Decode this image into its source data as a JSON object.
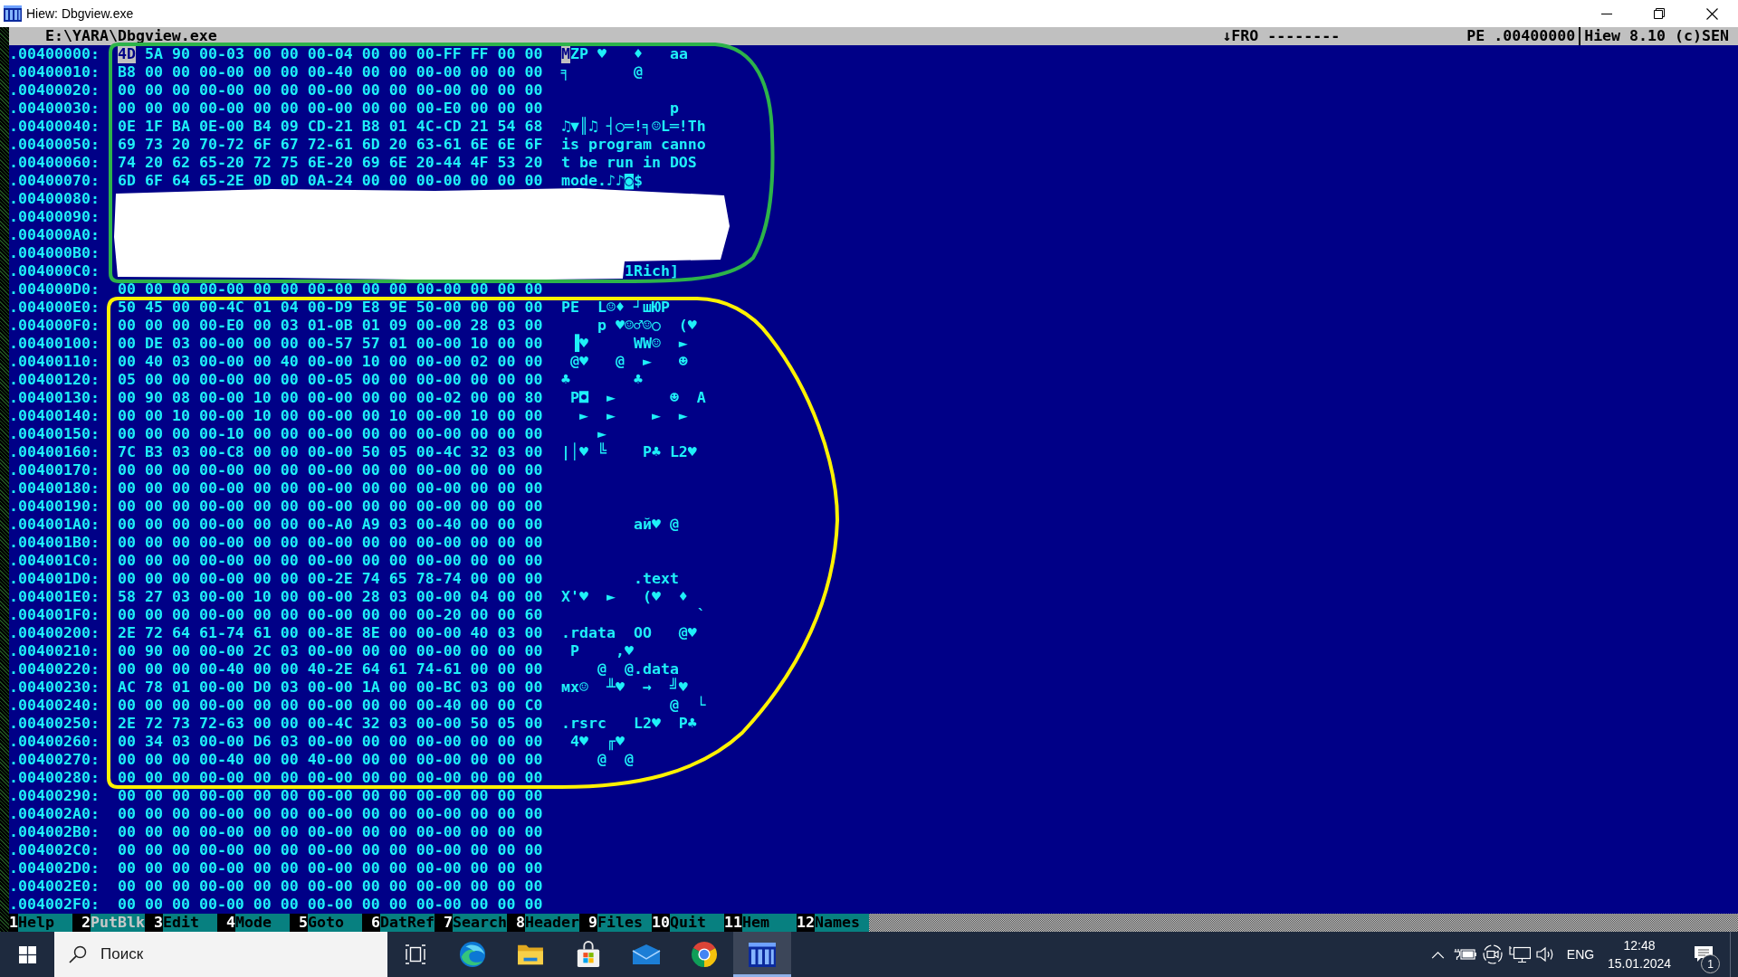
{
  "window": {
    "title": "Hiew: Dbgview.exe"
  },
  "status_line": {
    "file": "E:\\YARA\\Dbgview.exe",
    "mode": "↓FRO --------",
    "format": "PE .00400000",
    "version": "Hiew 8.10 (c)SEN"
  },
  "rows": [
    {
      "address": ".00400000:",
      "cursor": {
        "byte": "4D",
        "char": "M"
      },
      "hex": "5A 90 00-03 00 00 00-04 00 00 00-FF FF 00 00",
      "ascii": "ZP ♥   ♦   aa"
    },
    {
      "address": ".00400010:",
      "hex": "B8 00 00 00-00 00 00 00-40 00 00 00-00 00 00 00",
      "ascii": "╕       @"
    },
    {
      "address": ".00400020:",
      "hex": "00 00 00 00-00 00 00 00-00 00 00 00-00 00 00 00"
    },
    {
      "address": ".00400030:",
      "hex": "00 00 00 00-00 00 00 00-00 00 00 00-E0 00 00 00",
      "ascii": "            p"
    },
    {
      "address": ".00400040:",
      "hex": "0E 1F BA 0E-00 B4 09 CD-21 B8 01 4C-CD 21 54 68",
      "ascii": "♫▼║♫ ┤○═!╕☺L═!Th"
    },
    {
      "address": ".00400050:",
      "hex": "69 73 20 70-72 6F 67 72-61 6D 20 63-61 6E 6E 6F",
      "ascii": "is program canno"
    },
    {
      "address": ".00400060:",
      "hex": "74 20 62 65-20 72 75 6E-20 69 6E 20-44 4F 53 20",
      "ascii": "t be run in DOS"
    },
    {
      "address": ".00400070:",
      "hex": "6D 6F 64 65-2E 0D 0D 0A-24 00 00 00-00 00 00 00",
      "ascii": "mode.♪♪◙$"
    },
    {
      "address": ".00400080:"
    },
    {
      "address": ".00400090:"
    },
    {
      "address": ".004000A0:"
    },
    {
      "address": ".004000B0:"
    },
    {
      "address": ".004000C0:",
      "ascii": "       1Rich]"
    },
    {
      "address": ".004000D0:",
      "hex": "00 00 00 00-00 00 00 00-00 00 00 00-00 00 00 00"
    },
    {
      "address": ".004000E0:",
      "hex": "50 45 00 00-4C 01 04 00-D9 E8 9E 50-00 00 00 00",
      "ascii": "PE  L☺♦ ┘шЮP"
    },
    {
      "address": ".004000F0:",
      "hex": "00 00 00 00-E0 00 03 01-0B 01 09 00-00 28 03 00",
      "ascii": "    p ♥☺♂☺○  (♥"
    },
    {
      "address": ".00400100:",
      "hex": "00 DE 03 00-00 00 00 00-57 57 01 00-00 10 00 00",
      "ascii": " ▐♥     WW☺  ►"
    },
    {
      "address": ".00400110:",
      "hex": "00 40 03 00-00 00 40 00-00 10 00 00-00 02 00 00",
      "ascii": " @♥   @  ►   ☻"
    },
    {
      "address": ".00400120:",
      "hex": "05 00 00 00-00 00 00 00-05 00 00 00-00 00 00 00",
      "ascii": "♣       ♣"
    },
    {
      "address": ".00400130:",
      "hex": "00 90 08 00-00 10 00 00-00 00 00 00-02 00 00 80",
      "ascii": " P◘  ►      ☻  A"
    },
    {
      "address": ".00400140:",
      "hex": "00 00 10 00-00 10 00 00-00 00 10 00-00 10 00 00",
      "ascii": "  ►  ►    ►  ►"
    },
    {
      "address": ".00400150:",
      "hex": "00 00 00 00-10 00 00 00-00 00 00 00-00 00 00 00",
      "ascii": "    ►"
    },
    {
      "address": ".00400160:",
      "hex": "7C B3 03 00-C8 00 00 00-00 50 05 00-4C 32 03 00",
      "ascii": "|│♥ ╚    P♣ L2♥"
    },
    {
      "address": ".00400170:",
      "hex": "00 00 00 00-00 00 00 00-00 00 00 00-00 00 00 00"
    },
    {
      "address": ".00400180:",
      "hex": "00 00 00 00-00 00 00 00-00 00 00 00-00 00 00 00"
    },
    {
      "address": ".00400190:",
      "hex": "00 00 00 00-00 00 00 00-00 00 00 00-00 00 00 00"
    },
    {
      "address": ".004001A0:",
      "hex": "00 00 00 00-00 00 00 00-A0 A9 03 00-40 00 00 00",
      "ascii": "        ай♥ @"
    },
    {
      "address": ".004001B0:",
      "hex": "00 00 00 00-00 00 00 00-00 00 00 00-00 00 00 00"
    },
    {
      "address": ".004001C0:",
      "hex": "00 00 00 00-00 00 00 00-00 00 00 00-00 00 00 00"
    },
    {
      "address": ".004001D0:",
      "hex": "00 00 00 00-00 00 00 00-2E 74 65 78-74 00 00 00",
      "ascii": "        .text"
    },
    {
      "address": ".004001E0:",
      "hex": "58 27 03 00-00 10 00 00-00 28 03 00-00 04 00 00",
      "ascii": "X'♥  ►   (♥  ♦"
    },
    {
      "address": ".004001F0:",
      "hex": "00 00 00 00-00 00 00 00-00 00 00 00-20 00 00 60",
      "ascii": "               `"
    },
    {
      "address": ".00400200:",
      "hex": "2E 72 64 61-74 61 00 00-8E 8E 00 00-00 40 03 00",
      "ascii": ".rdata  OO   @♥"
    },
    {
      "address": ".00400210:",
      "hex": "00 90 00 00-00 2C 03 00-00 00 00 00-00 00 00 00",
      "ascii": " P    ,♥"
    },
    {
      "address": ".00400220:",
      "hex": "00 00 00 00-40 00 00 40-2E 64 61 74-61 00 00 00",
      "ascii": "    @  @.data"
    },
    {
      "address": ".00400230:",
      "hex": "AC 78 01 00-00 D0 03 00-00 1A 00 00-BC 03 00 00",
      "ascii": "мx☺  ╨♥  →  ╝♥"
    },
    {
      "address": ".00400240:",
      "hex": "00 00 00 00-00 00 00 00-00 00 00 00-40 00 00 C0",
      "ascii": "            @  └"
    },
    {
      "address": ".00400250:",
      "hex": "2E 72 73 72-63 00 00 00-4C 32 03 00-00 50 05 00",
      "ascii": ".rsrc   L2♥  P♣"
    },
    {
      "address": ".00400260:",
      "hex": "00 34 03 00-00 D6 03 00-00 00 00 00-00 00 00 00",
      "ascii": " 4♥  ╓♥"
    },
    {
      "address": ".00400270:",
      "hex": "00 00 00 00-40 00 00 40-00 00 00 00-00 00 00 00",
      "ascii": "    @  @"
    },
    {
      "address": ".00400280:",
      "hex": "00 00 00 00-00 00 00 00-00 00 00 00-00 00 00 00"
    },
    {
      "address": ".00400290:",
      "hex": "00 00 00 00-00 00 00 00-00 00 00 00-00 00 00 00"
    },
    {
      "address": ".004002A0:",
      "hex": "00 00 00 00-00 00 00 00-00 00 00 00-00 00 00 00"
    },
    {
      "address": ".004002B0:",
      "hex": "00 00 00 00-00 00 00 00-00 00 00 00-00 00 00 00"
    },
    {
      "address": ".004002C0:",
      "hex": "00 00 00 00-00 00 00 00-00 00 00 00-00 00 00 00"
    },
    {
      "address": ".004002D0:",
      "hex": "00 00 00 00-00 00 00 00-00 00 00 00-00 00 00 00"
    },
    {
      "address": ".004002E0:",
      "hex": "00 00 00 00-00 00 00 00-00 00 00 00-00 00 00 00"
    },
    {
      "address": ".004002F0:",
      "hex": "00 00 00 00-00 00 00 00-00 00 00 00-00 00 00 00"
    }
  ],
  "function_keys": [
    {
      "key": "1",
      "label": "Help",
      "disabled": false
    },
    {
      "key": "2",
      "label": "PutBlk",
      "disabled": true
    },
    {
      "key": "3",
      "label": "Edit",
      "disabled": false
    },
    {
      "key": "4",
      "label": "Mode",
      "disabled": false
    },
    {
      "key": "5",
      "label": "Goto",
      "disabled": false
    },
    {
      "key": "6",
      "label": "DatRef",
      "disabled": false
    },
    {
      "key": "7",
      "label": "Search",
      "disabled": false
    },
    {
      "key": "8",
      "label": "Header",
      "disabled": false
    },
    {
      "key": "9",
      "label": "Files",
      "disabled": false
    },
    {
      "key": "10",
      "label": "Quit",
      "disabled": false
    },
    {
      "key": "11",
      "label": "Hem",
      "disabled": false
    },
    {
      "key": "12",
      "label": "Names",
      "disabled": false
    }
  ],
  "taskbar": {
    "search": {
      "placeholder": "Поиск"
    },
    "apps": [
      {
        "kind": "edge",
        "selected": false
      },
      {
        "kind": "explorer",
        "selected": false
      },
      {
        "kind": "store",
        "selected": false
      },
      {
        "kind": "mail",
        "selected": false
      },
      {
        "kind": "chrome",
        "selected": false
      },
      {
        "kind": "hiew",
        "selected": true
      }
    ],
    "tray": {
      "language": "ENG",
      "time": "12:48",
      "date": "15.01.2024",
      "notification_count": "1"
    }
  }
}
